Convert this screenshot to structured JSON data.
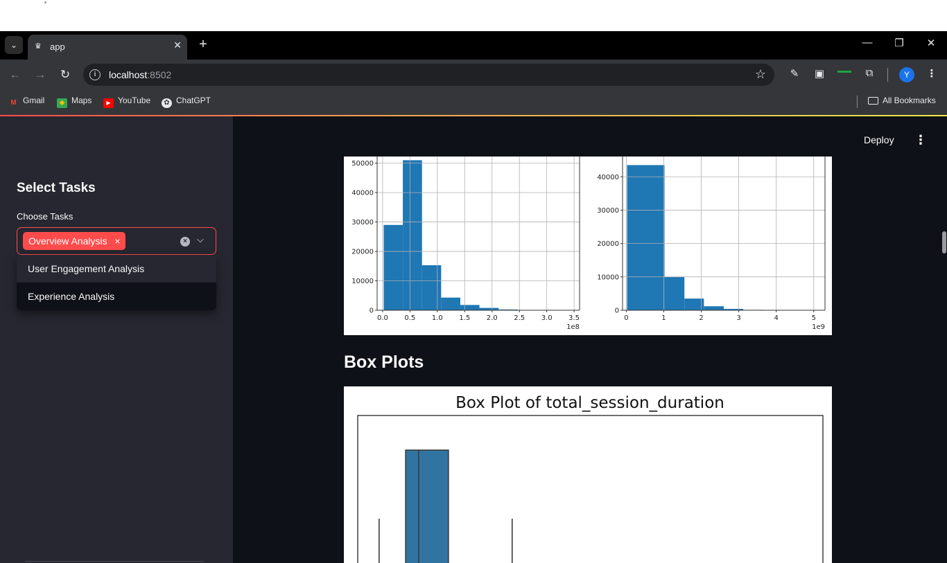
{
  "browser": {
    "tab_title": "app",
    "url_host": "localhost",
    "url_port": ":8502",
    "bookmarks": [
      "Gmail",
      "Maps",
      "YouTube",
      "ChatGPT"
    ],
    "all_bookmarks": "All Bookmarks",
    "profile_initial": "Y"
  },
  "header": {
    "deploy_label": "Deploy"
  },
  "sidebar": {
    "title": "Select Tasks",
    "multiselect_label": "Choose Tasks",
    "selected": [
      "Overview Analysis"
    ],
    "options": [
      "User Engagement Analysis",
      "Experience Analysis"
    ]
  },
  "main": {
    "box_heading": "Box Plots"
  },
  "colors": {
    "accent": "#ff4b4b",
    "bar": "#1f77b4",
    "box": "#3274a1"
  },
  "chart_data": [
    {
      "type": "bar",
      "title": "",
      "xlabel": "",
      "ylabel": "",
      "x_offset_label": "1e8",
      "xlim": [
        -0.1,
        3.6
      ],
      "ylim": [
        0,
        51000
      ],
      "bins": [
        {
          "start": 0.02,
          "end": 0.37,
          "value": 29000
        },
        {
          "start": 0.37,
          "end": 0.72,
          "value": 51000
        },
        {
          "start": 0.72,
          "end": 1.07,
          "value": 15300
        },
        {
          "start": 1.07,
          "end": 1.42,
          "value": 4300
        },
        {
          "start": 1.42,
          "end": 1.77,
          "value": 1800
        },
        {
          "start": 1.77,
          "end": 2.12,
          "value": 800
        },
        {
          "start": 2.12,
          "end": 2.47,
          "value": 250
        },
        {
          "start": 2.47,
          "end": 2.82,
          "value": 80
        },
        {
          "start": 2.82,
          "end": 3.17,
          "value": 30
        },
        {
          "start": 3.17,
          "end": 3.52,
          "value": 10
        }
      ],
      "xticks": [
        "0.0",
        "0.5",
        "1.0",
        "1.5",
        "2.0",
        "2.5",
        "3.0",
        "3.5"
      ],
      "xtick_values": [
        0.0,
        0.5,
        1.0,
        1.5,
        2.0,
        2.5,
        3.0,
        3.5
      ],
      "yticks": [
        "0",
        "10000",
        "20000",
        "30000",
        "40000",
        "50000"
      ],
      "ytick_values": [
        0,
        10000,
        20000,
        30000,
        40000,
        50000
      ],
      "grid": true
    },
    {
      "type": "bar",
      "title": "",
      "xlabel": "",
      "ylabel": "",
      "x_offset_label": "1e9",
      "xlim": [
        -0.1,
        5.3
      ],
      "ylim": [
        0,
        43500
      ],
      "bins": [
        {
          "start": 0.02,
          "end": 1.02,
          "value": 43500
        },
        {
          "start": 1.02,
          "end": 1.55,
          "value": 10000
        },
        {
          "start": 1.55,
          "end": 2.07,
          "value": 3500
        },
        {
          "start": 2.07,
          "end": 2.6,
          "value": 1200
        },
        {
          "start": 2.6,
          "end": 3.12,
          "value": 400
        },
        {
          "start": 3.12,
          "end": 3.65,
          "value": 120
        },
        {
          "start": 3.65,
          "end": 4.17,
          "value": 40
        },
        {
          "start": 4.17,
          "end": 4.7,
          "value": 15
        },
        {
          "start": 4.7,
          "end": 5.22,
          "value": 5
        }
      ],
      "xticks": [
        "0",
        "1",
        "2",
        "3",
        "4",
        "5"
      ],
      "xtick_values": [
        0,
        1,
        2,
        3,
        4,
        5
      ],
      "yticks": [
        "0",
        "10000",
        "20000",
        "30000",
        "40000"
      ],
      "ytick_values": [
        0,
        10000,
        20000,
        30000,
        40000
      ],
      "grid": true
    },
    {
      "type": "box",
      "title": "Box Plot of total_session_duration",
      "xlim": [
        0,
        1
      ],
      "box": {
        "whisker_low": 0.046,
        "q1": 0.103,
        "median": 0.131,
        "q3": 0.195,
        "whisker_high": 0.332
      }
    }
  ]
}
